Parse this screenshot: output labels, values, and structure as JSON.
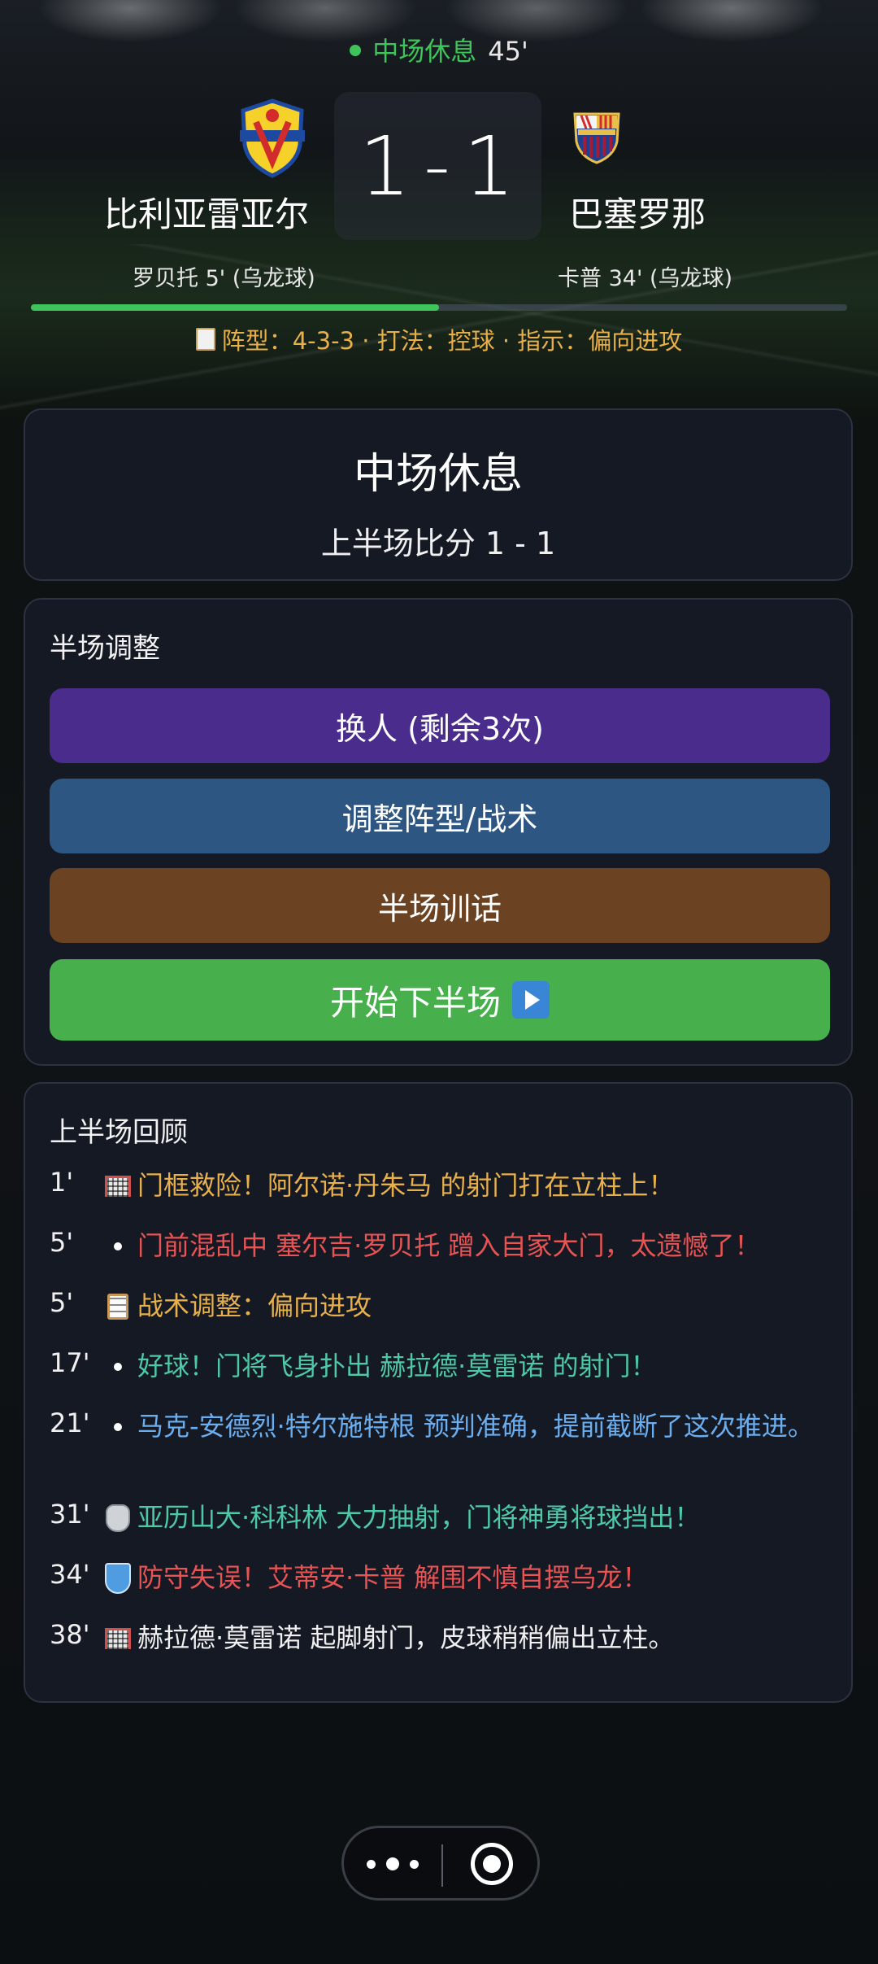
{
  "header": {
    "status": "中场休息",
    "minute": "45'",
    "score_home": "1",
    "score_sep": "-",
    "score_away": "1",
    "home_team": "比利亚雷亚尔",
    "away_team": "巴塞罗那",
    "home_scorer": "罗贝托 5' (乌龙球)",
    "away_scorer": "卡普 34' (乌龙球)",
    "match_progress": 0.5,
    "tactics_line": "阵型：4-3-3 · 打法：控球 · 指示：偏向进攻"
  },
  "halftime": {
    "title": "中场休息",
    "subtitle": "上半场比分 1 - 1"
  },
  "adjust": {
    "title": "半场调整",
    "sub_button": "换人 (剩余3次)",
    "tactics_button": "调整阵型/战术",
    "talk_button": "半场训话",
    "start_button": "开始下半场"
  },
  "review": {
    "title": "上半场回顾",
    "events": [
      {
        "minute": "1'",
        "icon": "goal-net-icon",
        "text": "门框救险！阿尔诺·丹朱马 的射门打在立柱上！",
        "color": "#e8b04a"
      },
      {
        "minute": "5'",
        "icon": "bullet-icon",
        "text": "门前混乱中 塞尔吉·罗贝托 蹭入自家大门，太遗憾了！",
        "color": "#e85454"
      },
      {
        "minute": "5'",
        "icon": "clipboard-icon",
        "text": "战术调整：偏向进攻",
        "color": "#e8b04a"
      },
      {
        "minute": "17'",
        "icon": "bullet-icon",
        "text": "好球！门将飞身扑出 赫拉德·莫雷诺 的射门！",
        "color": "#4ec9a8"
      },
      {
        "minute": "21'",
        "icon": "bullet-icon",
        "text": "马克-安德烈·特尔施特根 预判准确，提前截断了这次推进。",
        "color": "#6aaef0"
      },
      {
        "minute": "31'",
        "icon": "glove-icon",
        "text": "亚历山大·科科林 大力抽射，门将神勇将球挡出！",
        "color": "#4ec9a8"
      },
      {
        "minute": "34'",
        "icon": "shield-icon",
        "text": "防守失误！艾蒂安·卡普 解围不慎自摆乌龙！",
        "color": "#e85454"
      },
      {
        "minute": "38'",
        "icon": "goal-net-icon",
        "text": "赫拉德·莫雷诺 起脚射门，皮球稍稍偏出立柱。",
        "color": "#f0f0f0"
      }
    ]
  },
  "system_bar": {
    "more_icon": "more-dots-icon",
    "close_icon": "target-close-icon"
  }
}
